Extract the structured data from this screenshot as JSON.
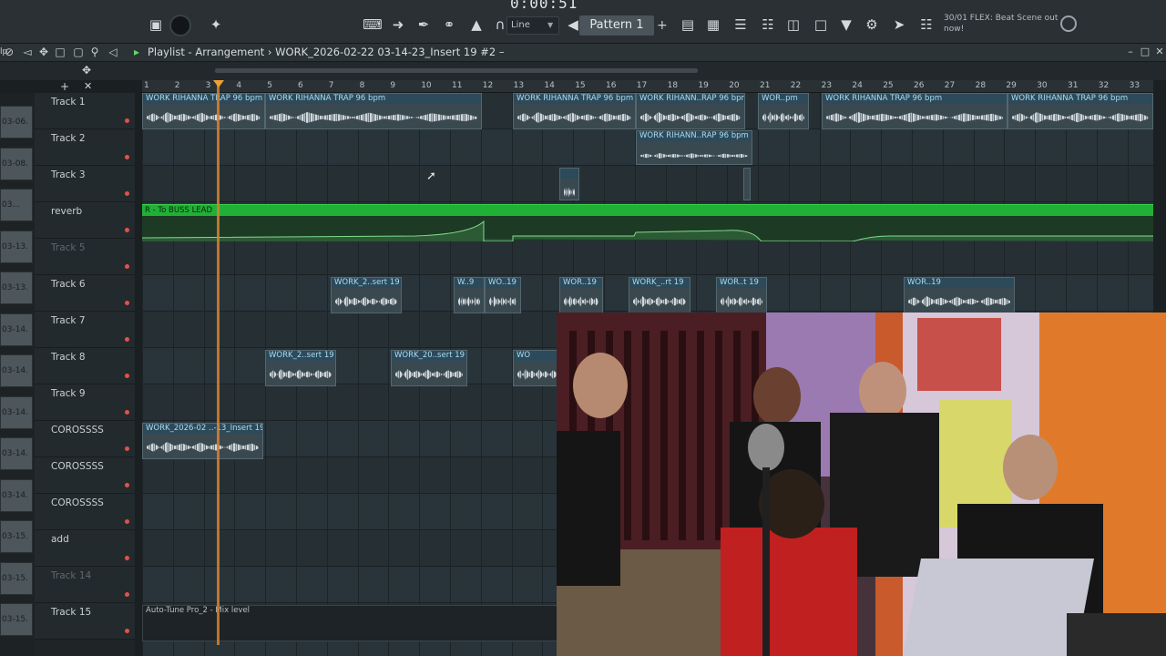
{
  "toolbar": {
    "time": "0:00:51",
    "snap_label": "Line",
    "pattern_label": "Pattern 1",
    "pattern_add": "+",
    "news_text": "30/01  FLEX: Beat Scene out now!"
  },
  "window": {
    "title": "Playlist - Arrangement › WORK_2026-02-22 03-14-23_Insert 19 #2 –",
    "left_label": "lp"
  },
  "ruler": {
    "bars": [
      "1",
      "2",
      "3",
      "4",
      "5",
      "6",
      "7",
      "8",
      "9",
      "10",
      "11",
      "12",
      "13",
      "14",
      "15",
      "16",
      "17",
      "18",
      "19",
      "20",
      "21",
      "22",
      "23",
      "24",
      "25",
      "26",
      "27",
      "28",
      "29",
      "30",
      "31",
      "32",
      "33"
    ]
  },
  "side_strip": [
    "03-06.",
    "03-08.",
    "03...",
    "03-13.",
    "03-13.",
    "03-14.",
    "03-14.",
    "03-14.",
    "03-14.",
    "03-14.",
    "03-15.",
    "03-15.",
    "03-15."
  ],
  "tracks": [
    {
      "name": "Track 1",
      "dim": false
    },
    {
      "name": "Track 2",
      "dim": false
    },
    {
      "name": "Track 3",
      "dim": false
    },
    {
      "name": "reverb",
      "dim": false
    },
    {
      "name": "Track 5",
      "dim": true
    },
    {
      "name": "Track 6",
      "dim": false
    },
    {
      "name": "Track 7",
      "dim": false
    },
    {
      "name": "Track 8",
      "dim": false
    },
    {
      "name": "Track 9",
      "dim": false
    },
    {
      "name": "COROSSSS",
      "dim": false
    },
    {
      "name": "COROSSSS",
      "dim": false
    },
    {
      "name": "COROSSSS",
      "dim": false
    },
    {
      "name": "add",
      "dim": false
    },
    {
      "name": "Track 14",
      "dim": true
    },
    {
      "name": "Track 15",
      "dim": false
    }
  ],
  "clips": {
    "t1a": "WORK RIHANNA TRAP 96 bpm",
    "t1b": "WORK RIHANNA TRAP 96 bpm",
    "t1c": "WORK RIHANNA TRAP 96 bpm",
    "t1d": "WORK RIHANN..RAP 96 bpm",
    "t1e": "WOR..pm",
    "t1f": "WORK RIHANNA TRAP 96 bpm",
    "t1g": "WORK RIHANNA TRAP 96 bpm",
    "t2a": "WORK RIHANN..RAP 96 bpm",
    "auto_reverb": "R - To BUSS LEAD",
    "t6a": "WORK_2..sert 19",
    "t6b": "W..9",
    "t6c": "WO..19",
    "t6d": "WOR..19",
    "t6e": "WORK_..rt 19",
    "t6f": "WOR..t 19",
    "t6g": "WOR..19",
    "t8a": "WORK_2..sert 19",
    "t8b": "WORK_20..sert 19",
    "t8c": "WO",
    "t10a": "WORK_2026-02 ..-13_Insert 19",
    "auto_track15": "Auto-Tune Pro_2 - Mix level"
  }
}
